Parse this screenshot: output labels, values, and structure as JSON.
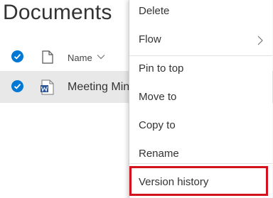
{
  "page": {
    "title": "Documents"
  },
  "list": {
    "column_name": "Name",
    "rows": [
      {
        "name": "Meeting Minutes",
        "selected": true,
        "file_type": "word"
      }
    ]
  },
  "context_menu": {
    "items": [
      {
        "label": "Delete"
      },
      {
        "label": "Flow",
        "has_submenu": true
      },
      {
        "label": "Pin to top"
      },
      {
        "label": "Move to"
      },
      {
        "label": "Copy to"
      },
      {
        "label": "Rename"
      },
      {
        "label": "Version history",
        "highlighted": true
      }
    ]
  },
  "colors": {
    "accent": "#0078d4",
    "highlight": "#d4121e",
    "selected_row": "#e8e8e8"
  }
}
